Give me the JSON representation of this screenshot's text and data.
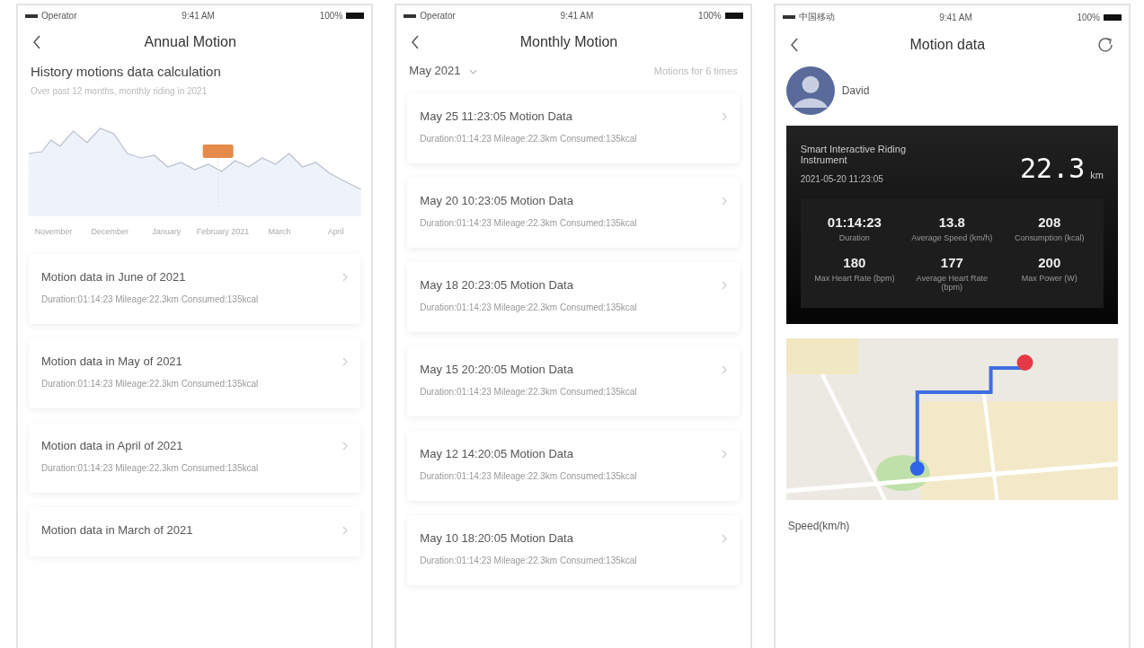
{
  "screens": [
    {
      "kind": "annual",
      "status": {
        "carrier": "Operator",
        "time": "9:41 AM",
        "battery": "100%"
      },
      "title": "Annual Motion",
      "heading": "History motions data calculation",
      "subheading": "Over past 12 months, monthly riding in 2021",
      "chart_months": [
        "November",
        "December",
        "January",
        "February 2021",
        "March",
        "April"
      ],
      "items": [
        {
          "title": "Motion data in June of 2021",
          "detail": "Duration:01:14:23 Mileage:22.3km Consumed:135kcal"
        },
        {
          "title": "Motion data in May of 2021",
          "detail": "Duration:01:14:23 Mileage:22.3km Consumed:135kcal"
        },
        {
          "title": "Motion data in April of 2021",
          "detail": "Duration:01:14:23 Mileage:22.3km Consumed:135kcal"
        },
        {
          "title": "Motion data in March of 2021"
        }
      ]
    },
    {
      "kind": "monthly",
      "status": {
        "carrier": "Operator",
        "time": "9:41 AM",
        "battery": "100%"
      },
      "title": "Monthly Motion",
      "month": "May 2021",
      "count": "Motions for 6 times",
      "items": [
        {
          "title": "May 25 11:23:05 Motion Data",
          "detail": "Duration:01:14:23 Mileage:22.3km Consumed:135kcal"
        },
        {
          "title": "May 20 10:23:05 Motion Data",
          "detail": "Duration:01:14:23 Mileage:22.3km Consumed:135kcal"
        },
        {
          "title": "May 18 20:23:05 Motion Data",
          "detail": "Duration:01:14:23 Mileage:22.3km Consumed:135kcal"
        },
        {
          "title": "May 15 20:20:05 Motion Data",
          "detail": "Duration:01:14:23 Mileage:22.3km Consumed:135kcal"
        },
        {
          "title": "May 12 14:20:05 Motion Data",
          "detail": "Duration:01:14:23 Mileage:22.3km Consumed:135kcal"
        },
        {
          "title": "May 10 18:20:05 Motion Data",
          "detail": "Duration:01:14:23 Mileage:22.3km Consumed:135kcal"
        }
      ]
    },
    {
      "kind": "detail",
      "status": {
        "carrier": "中国移动",
        "time": "9:41 AM",
        "battery": "100%"
      },
      "title": "Motion data",
      "user": "David",
      "device": "Smart Interactive Riding Instrument",
      "date": "2021-05-20  11:23:05",
      "distance": "22.3",
      "unit": "km",
      "stats": [
        {
          "value": "01:14:23",
          "label": "Duration"
        },
        {
          "value": "13.8",
          "label": "Average Speed (km/h)"
        },
        {
          "value": "208",
          "label": "Consumption (kcal)"
        },
        {
          "value": "180",
          "label": "Max Heart Rate (bpm)"
        },
        {
          "value": "177",
          "label": "Average Heart Rate (bpm)"
        },
        {
          "value": "200",
          "label": "Max Power (W)"
        }
      ],
      "section": "Speed(km/h)"
    }
  ]
}
